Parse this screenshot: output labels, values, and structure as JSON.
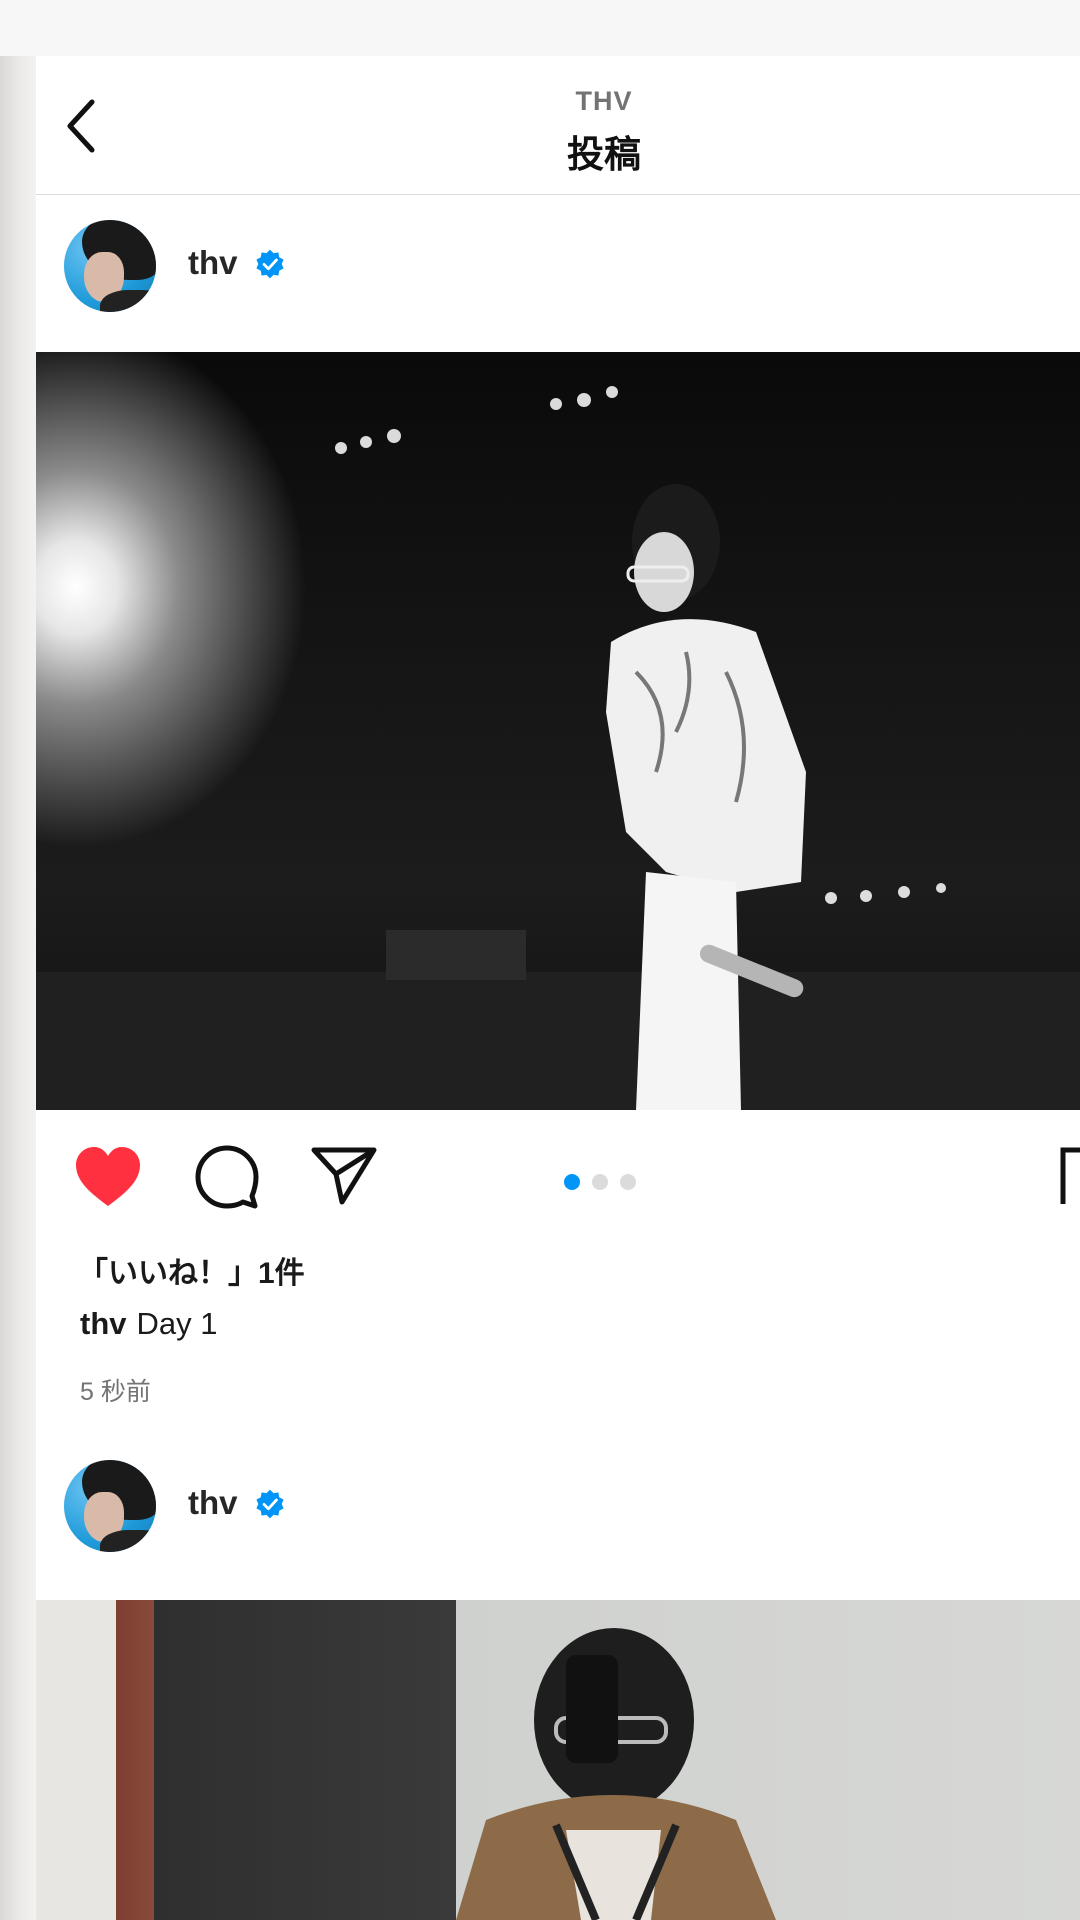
{
  "header": {
    "subtitle": "THV",
    "title": "投稿"
  },
  "posts": [
    {
      "username": "thv",
      "verified": true,
      "likes_text": "「いいね！」1件",
      "caption_user": "thv",
      "caption_text": "Day 1",
      "timestamp": "5 秒前",
      "carousel": {
        "count": 3,
        "active_index": 0
      },
      "liked": true
    },
    {
      "username": "thv",
      "verified": true
    }
  ],
  "icons": {
    "back": "chevron-left-icon",
    "like": "heart-icon",
    "comment": "comment-bubble-icon",
    "share": "paper-plane-icon",
    "save": "bookmark-icon",
    "verified": "verified-badge-icon"
  },
  "colors": {
    "like_red": "#ff3040",
    "verified_blue": "#0095f6",
    "dot_active": "#0095f6",
    "dot_inactive": "#dbdbdb"
  }
}
